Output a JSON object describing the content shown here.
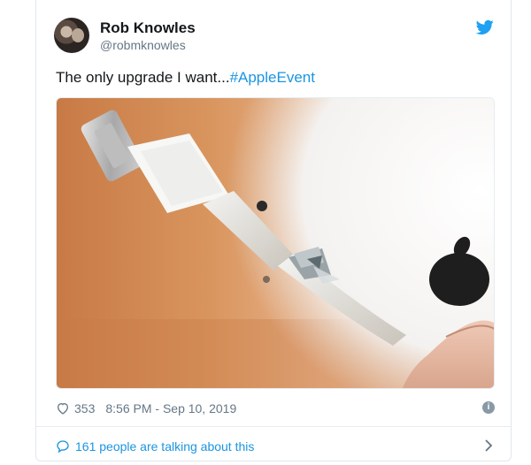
{
  "author": {
    "name": "Rob Knowles",
    "handle": "@robmknowles"
  },
  "tweet": {
    "text": "The only upgrade I want...",
    "hashtag": "#AppleEvent"
  },
  "meta": {
    "likes": "353",
    "timestamp": "8:56 PM - Sep 10, 2019"
  },
  "footer": {
    "talking_label": "161 people are talking about this"
  },
  "icons": {
    "brand": "twitter-bird-icon",
    "like": "heart-icon",
    "info": "info-icon",
    "reply": "speech-bubble-icon",
    "more": "chevron-right-icon"
  },
  "colors": {
    "link": "#1b95e0",
    "text": "#14171a",
    "muted": "#657786"
  }
}
